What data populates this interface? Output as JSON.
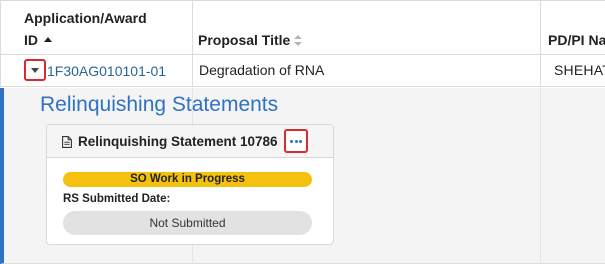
{
  "table": {
    "columns": [
      {
        "label_line1": "Application/Award",
        "label_line2": "ID",
        "sort": "ascending"
      },
      {
        "label_line1": "",
        "label_line2": "Proposal Title",
        "sort": "none"
      },
      {
        "label_line1": "",
        "label_line2": "PD/PI Na",
        "sort": "none"
      }
    ],
    "row": {
      "application_id": "1F30AG010101-01",
      "proposal_title": "Degradation of RNA",
      "pd_pi": "SHEHAT"
    }
  },
  "detail": {
    "heading": "Relinquishing Statements",
    "card": {
      "title": "Relinquishing Statement 10786",
      "status": "SO Work in Progress",
      "date_label": "RS Submitted Date:",
      "date_value": "Not Submitted"
    }
  },
  "colors": {
    "accent_blue": "#2f72c4",
    "link_blue": "#2a6496",
    "status_yellow": "#f4c20d",
    "highlight_red": "#d92b2b"
  },
  "icons": {
    "expand": "chevron-down-icon",
    "sort_ascending": "sort-ascending-icon",
    "sort_both": "sort-icon",
    "document": "document-icon",
    "more": "more-options-icon"
  }
}
